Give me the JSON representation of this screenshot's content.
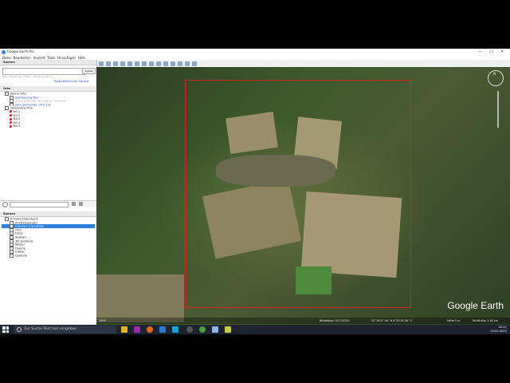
{
  "window": {
    "title": "Google Earth Pro",
    "minimize": "—",
    "maximize": "□",
    "close": "✕"
  },
  "menubar": [
    "Datei",
    "Bearbeiten",
    "Ansicht",
    "Tools",
    "Hinzufügen",
    "Hilfe"
  ],
  "search": {
    "header": "Suchen",
    "button": "Suche",
    "hint": "Bsp.: Hamburger Hafen - Hamburg-Altona",
    "links": [
      "Route berechnen",
      "Verlauf"
    ]
  },
  "places": {
    "header": "Orte",
    "items": [
      {
        "label": "Meine Orte",
        "type": "folder"
      },
      {
        "label": "Sightseeing-Tour",
        "type": "link"
      },
      {
        "label": "Zuerst die Ebene \"3D-Gebäude\" aktivieren",
        "type": "sub"
      },
      {
        "label": "plan_gemeinde_dhm.kml",
        "type": "link"
      },
      {
        "label": "Temporäre Orte",
        "type": "folder"
      },
      {
        "label": "Teil 1",
        "type": "pin"
      },
      {
        "label": "Teil 2",
        "type": "pin"
      },
      {
        "label": "Teil 3",
        "type": "pin"
      },
      {
        "label": "Teil 4",
        "type": "pin"
      },
      {
        "label": "Teil 5",
        "type": "pin"
      }
    ]
  },
  "layers": {
    "header": "Ebenen",
    "items": [
      {
        "label": "Primäre Datenbank",
        "selected": false
      },
      {
        "label": "Ankündigungen",
        "selected": false
      },
      {
        "label": "Grenzen und Labels",
        "selected": true
      },
      {
        "label": "Orte",
        "selected": false
      },
      {
        "label": "Fotos",
        "selected": false
      },
      {
        "label": "Straßen",
        "selected": false
      },
      {
        "label": "3D-Gebäude",
        "selected": false
      },
      {
        "label": "Wetter",
        "selected": false
      },
      {
        "label": "Galerie",
        "selected": false
      },
      {
        "label": "Global",
        "selected": false
      },
      {
        "label": "Gelände",
        "selected": false
      }
    ]
  },
  "map": {
    "logo": "Google Earth",
    "compass_label": "N",
    "status": {
      "scale": "1995",
      "date": "Bilddatum: 9/17/2020",
      "coords": "52°16'47.04\" N   9°20'35.36\" O",
      "elevation": "Höhe  0 m",
      "eye_alt": "Sichthöhe  1.18 km"
    }
  },
  "taskbar": {
    "search_placeholder": "Zur Suche Text hier eingeben",
    "time": "22:21",
    "date": "15.01.2022"
  },
  "colors": {
    "selection": "#2f7ed8",
    "box": "#e0201f",
    "taskbar": "#1c2430"
  }
}
